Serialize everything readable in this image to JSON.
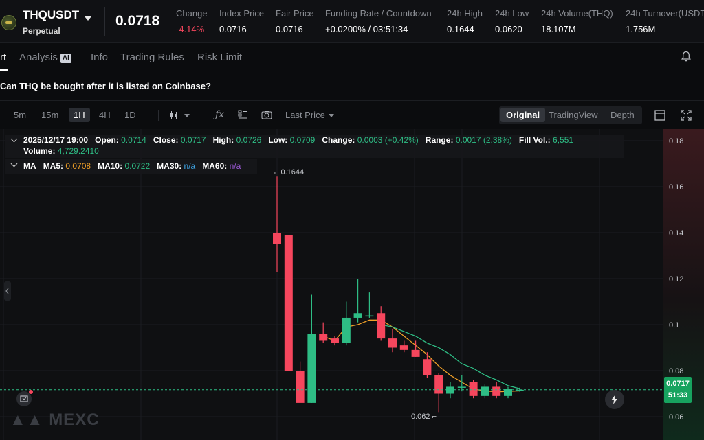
{
  "header": {
    "symbol": "THQUSDT",
    "contract_type": "Perpetual",
    "last_price": "0.0718",
    "stats": [
      {
        "label": "Change",
        "value": "-4.14%",
        "negative": true
      },
      {
        "label": "Index Price",
        "value": "0.0716"
      },
      {
        "label": "Fair Price",
        "value": "0.0716"
      },
      {
        "label": "Funding Rate  /  Countdown",
        "value": "+0.0200%  /  03:51:34"
      },
      {
        "label": "24h High",
        "value": "0.1644"
      },
      {
        "label": "24h Low",
        "value": "0.0620"
      },
      {
        "label": "24h Volume(THQ)",
        "value": "18.107M"
      },
      {
        "label": "24h Turnover(USDT",
        "value": "1.756M"
      }
    ]
  },
  "tabs": [
    {
      "label": "rt",
      "active": true
    },
    {
      "label": "Analysis",
      "badge": "AI"
    },
    {
      "label": "Info"
    },
    {
      "label": "Trading Rules"
    },
    {
      "label": "Risk Limit"
    }
  ],
  "question": "Can THQ be bought after it is listed on Coinbase?",
  "toolbar": {
    "timeframes": [
      "5m",
      "15m",
      "1H",
      "4H",
      "1D"
    ],
    "active_timeframe": "1H",
    "price_type": "Last Price",
    "views": [
      "Original",
      "TradingView",
      "Depth"
    ],
    "active_view": "Original"
  },
  "legend": {
    "datetime": "2025/12/17 19:00",
    "open_label": "Open:",
    "open": "0.0714",
    "close_label": "Close:",
    "close": "0.0717",
    "high_label": "High:",
    "high": "0.0726",
    "low_label": "Low:",
    "low": "0.0709",
    "change_label": "Change:",
    "change": "0.0003 (+0.42%)",
    "range_label": "Range:",
    "range": "0.0017 (2.38%)",
    "fillvol_label": "Fill Vol.:",
    "fillvol": "6,551",
    "volume_label": "Volume:",
    "volume": "4,729.2410",
    "ma_label": "MA",
    "ma5_label": "MA5:",
    "ma5": "0.0708",
    "ma10_label": "MA10:",
    "ma10": "0.0722",
    "ma30_label": "MA30:",
    "ma30": "n/a",
    "ma60_label": "MA60:",
    "ma60": "n/a"
  },
  "current_price_tag": {
    "price": "0.0717",
    "countdown": "51:33"
  },
  "high_marker": "0.1644",
  "low_marker": "0.062",
  "watermark": "MEXC",
  "colors": {
    "up": "#2ebd85",
    "down": "#f6465d",
    "ma5": "#f0a028",
    "ma10": "#2ebd85"
  },
  "chart_data": {
    "type": "candlestick",
    "y_axis_ticks": [
      "0.18",
      "0.16",
      "0.14",
      "0.12",
      "0.1",
      "0.08",
      "0.06"
    ],
    "ylim": [
      0.055,
      0.184
    ],
    "candles": [
      {
        "o": 0.14,
        "h": 0.1644,
        "l": 0.123,
        "c": 0.135
      },
      {
        "o": 0.139,
        "h": 0.139,
        "l": 0.08,
        "c": 0.08
      },
      {
        "o": 0.08,
        "h": 0.084,
        "l": 0.074,
        "c": 0.066
      },
      {
        "o": 0.066,
        "h": 0.113,
        "l": 0.066,
        "c": 0.096
      },
      {
        "o": 0.096,
        "h": 0.101,
        "l": 0.092,
        "c": 0.093
      },
      {
        "o": 0.094,
        "h": 0.095,
        "l": 0.091,
        "c": 0.092
      },
      {
        "o": 0.092,
        "h": 0.11,
        "l": 0.091,
        "c": 0.103
      },
      {
        "o": 0.103,
        "h": 0.12,
        "l": 0.101,
        "c": 0.105
      },
      {
        "o": 0.104,
        "h": 0.114,
        "l": 0.103,
        "c": 0.104
      },
      {
        "o": 0.105,
        "h": 0.108,
        "l": 0.093,
        "c": 0.094
      },
      {
        "o": 0.094,
        "h": 0.098,
        "l": 0.088,
        "c": 0.09
      },
      {
        "o": 0.091,
        "h": 0.093,
        "l": 0.088,
        "c": 0.089
      },
      {
        "o": 0.089,
        "h": 0.093,
        "l": 0.086,
        "c": 0.086
      },
      {
        "o": 0.085,
        "h": 0.088,
        "l": 0.077,
        "c": 0.078
      },
      {
        "o": 0.078,
        "h": 0.079,
        "l": 0.062,
        "c": 0.07
      },
      {
        "o": 0.07,
        "h": 0.075,
        "l": 0.068,
        "c": 0.073
      },
      {
        "o": 0.073,
        "h": 0.078,
        "l": 0.071,
        "c": 0.073
      },
      {
        "o": 0.075,
        "h": 0.076,
        "l": 0.068,
        "c": 0.069
      },
      {
        "o": 0.069,
        "h": 0.074,
        "l": 0.068,
        "c": 0.073
      },
      {
        "o": 0.073,
        "h": 0.075,
        "l": 0.068,
        "c": 0.069
      },
      {
        "o": 0.069,
        "h": 0.073,
        "l": 0.068,
        "c": 0.072
      },
      {
        "o": 0.0714,
        "h": 0.0726,
        "l": 0.0709,
        "c": 0.0717
      }
    ],
    "ma5": [
      null,
      null,
      null,
      null,
      0.095,
      0.093,
      0.099,
      0.1,
      0.102,
      0.102,
      0.099,
      0.095,
      0.091,
      0.087,
      0.082,
      0.078,
      0.075,
      0.072,
      0.0712,
      0.0708,
      0.071,
      0.0712
    ],
    "ma10": [
      null,
      null,
      null,
      null,
      null,
      null,
      null,
      null,
      null,
      0.1,
      0.099,
      0.097,
      0.095,
      0.092,
      0.09,
      0.087,
      0.083,
      0.081,
      0.078,
      0.076,
      0.0735,
      0.0722
    ],
    "current_price": 0.0717
  }
}
